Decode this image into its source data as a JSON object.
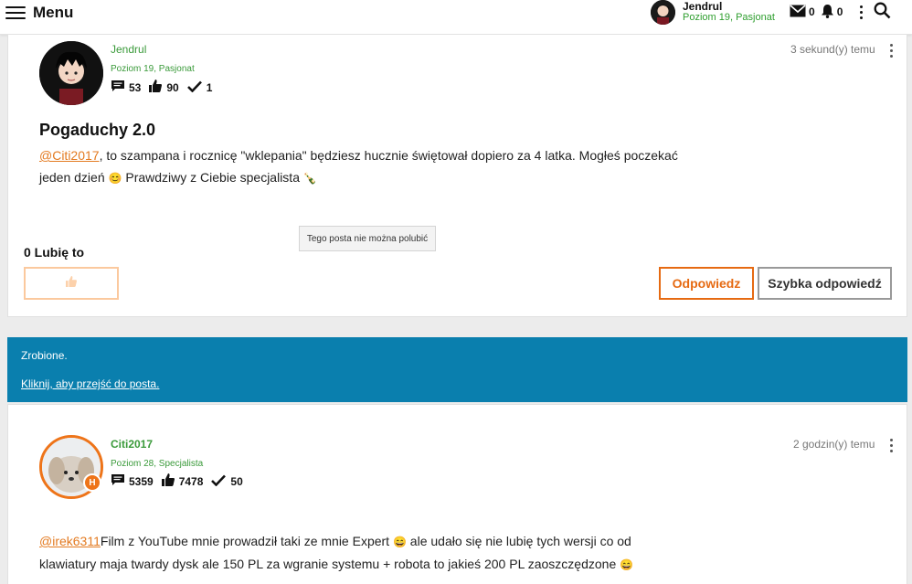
{
  "header": {
    "menu_label": "Menu",
    "user_name": "Jendrul",
    "user_level": "Poziom 19, Pasjonat",
    "messages_count": "0",
    "notifications_count": "0"
  },
  "post1": {
    "author": "Jendrul",
    "level": "Poziom 19, Pasjonat",
    "posts": "53",
    "likes": "90",
    "solutions": "1",
    "time": "3 sekund(y) temu",
    "title": "Pogaduchy 2.0",
    "mention": "@Citi2017",
    "text1": ", to szampana i rocznicę  \"wklepania\" będziesz hucznie świętował dopiero za 4 latka. Mogłeś poczekać",
    "text2a": "jeden dzień ",
    "emoji_smile": "😊",
    "text2b": " Prawdziwy z Ciebie specjalista ",
    "emoji_bottle": "🍾",
    "tooltip": "Tego posta nie można polubić",
    "likes_label": "0 Lubię to",
    "reply_label": "Odpowiedz",
    "quick_reply_label": "Szybka odpowiedź"
  },
  "banner": {
    "text": "Zrobione.",
    "link": "Kliknij, aby przejść do posta."
  },
  "post2": {
    "author": "Citi2017",
    "level": "Poziom 28, Specjalista",
    "badge": "H",
    "posts": "5359",
    "likes": "7478",
    "solutions": "50",
    "time": "2 godzin(y) temu",
    "mention": "@irek6311",
    "text1a": "Film z YouTube mnie prowadził  taki ze mnie Expert ",
    "emoji_grin": "😄",
    "text1b": " ale udało się nie lubię tych wersji co od",
    "text2": "klawiatury maja twardy dysk ale 150 PL za wgranie systemu + robota to jakieś 200 PL  zaoszczędzone "
  },
  "colors": {
    "accent_orange": "#e66a12",
    "level_green": "#3a9a3a",
    "banner_blue": "#0a7fae"
  }
}
